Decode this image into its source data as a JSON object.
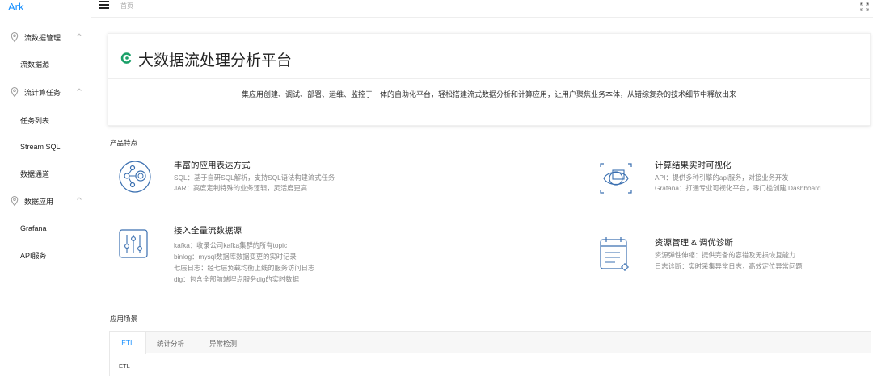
{
  "app": {
    "logo": "Ark"
  },
  "sidebar": {
    "groups": [
      {
        "label": "流数据管理",
        "items": [
          "流数据源"
        ]
      },
      {
        "label": "流计算任务",
        "items": [
          "任务列表",
          "Stream SQL",
          "数据通道"
        ]
      },
      {
        "label": "数据应用",
        "items": [
          "Grafana",
          "API服务"
        ]
      }
    ]
  },
  "header": {
    "breadcrumb": "首页"
  },
  "hero": {
    "title": "大数据流处理分析平台",
    "description": "集应用创建、调试、部署、运维、监控于一体的自助化平台，轻松搭建流式数据分析和计算应用，让用户聚焦业务本体，从错综复杂的技术细节中释放出来"
  },
  "features_title": "产品特点",
  "features": [
    {
      "title": "丰富的应用表达方式",
      "lines": [
        "SQL：基于自研SQL解析，支持SQL语法构建流式任务",
        "JAR：高度定制特殊的业务逻辑，灵活度更高"
      ],
      "icon": "share-nodes-icon"
    },
    {
      "title": "计算结果实时可视化",
      "lines": [
        "API：提供多种引擎的api服务，对接业务开发",
        "Grafana：打通专业可视化平台，零门槛创建 Dashboard"
      ],
      "icon": "visualization-icon"
    },
    {
      "title": "接入全量流数据源",
      "lines": [
        "kafka：收录公司kafka集群的所有topic",
        "binlog：mysql数据库数据变更的实时记录",
        "七层日志：经七层负载均衡上线的服务访问日志",
        "dig：包含全部前端埋点服务dig的实时数据"
      ],
      "icon": "sliders-icon"
    },
    {
      "title": "资源管理 & 调优诊断",
      "lines": [
        "资源弹性伸缩：提供完备的容错及无损恢复能力",
        "日志诊断：实时采集异常日志，高效定位异常问题"
      ],
      "icon": "calendar-gear-icon"
    }
  ],
  "scenes_title": "应用场景",
  "tabs": [
    "ETL",
    "统计分析",
    "异常检测"
  ],
  "active_tab_content": "ETL",
  "colors": {
    "accent": "#1890ff",
    "brand_green": "#1aa068"
  }
}
